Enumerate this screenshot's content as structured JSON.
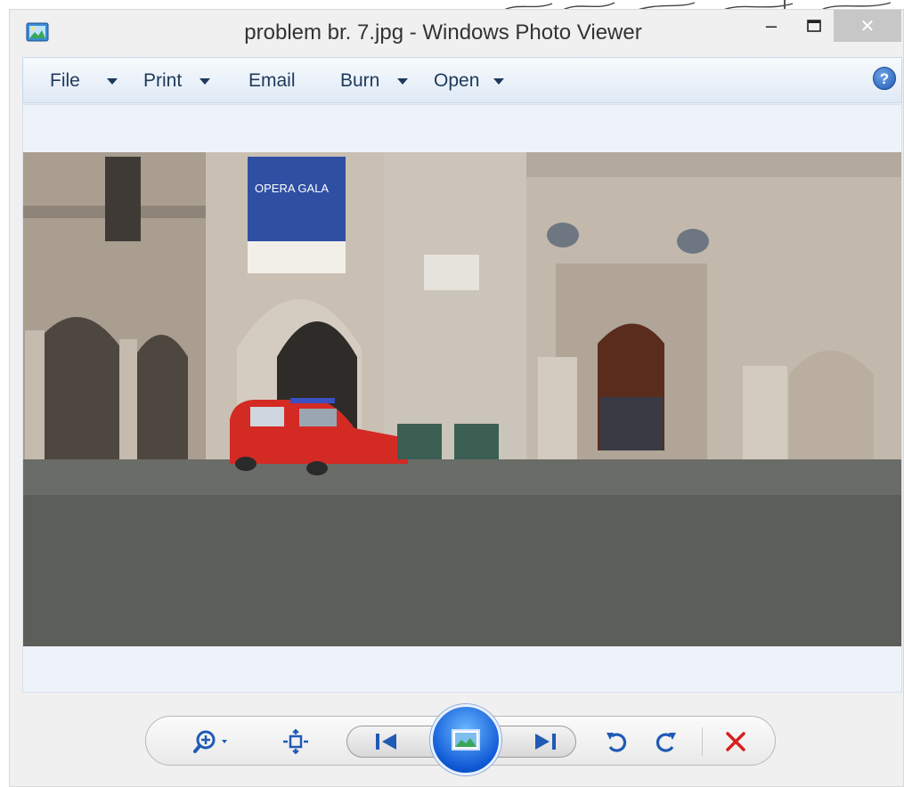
{
  "window": {
    "title": "problem br. 7.jpg - Windows Photo Viewer",
    "icons": {
      "app": "photo-viewer-app-icon",
      "minimize": "minimize-icon",
      "maximize": "maximize-icon",
      "close": "close-icon"
    },
    "minimize_glyph": "–",
    "maximize_glyph": "□",
    "close_glyph": "✕"
  },
  "menu": {
    "file": "File",
    "print": "Print",
    "email": "Email",
    "burn": "Burn",
    "open": "Open",
    "help_glyph": "?",
    "icons": {
      "dropdown": "chevron-down-icon",
      "help": "help-icon"
    }
  },
  "image": {
    "description_icon": "photo-flooded-square-fire-truck"
  },
  "toolbar": {
    "icons": [
      "zoom-icon",
      "actual-size-icon",
      "previous-icon",
      "slideshow-icon",
      "next-icon",
      "rotate-counterclockwise-icon",
      "rotate-clockwise-icon",
      "delete-icon"
    ]
  },
  "colors": {
    "menu_text": "#1e395b",
    "accent_blue": "#1f5ab5",
    "delete_red": "#d81e1e",
    "viewer_bg": "#eef3fa"
  }
}
